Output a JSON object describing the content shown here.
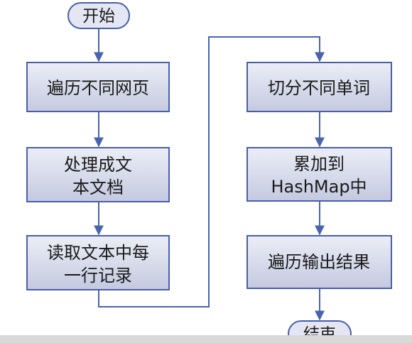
{
  "flowchart": {
    "start": {
      "label": "开始"
    },
    "left_column": [
      {
        "id": "step-traverse-pages",
        "lines": [
          "遍历不同网页"
        ]
      },
      {
        "id": "step-process-doc",
        "lines": [
          "处理成文",
          "本文档"
        ]
      },
      {
        "id": "step-read-lines",
        "lines": [
          "读取文本中每",
          "一行记录"
        ]
      }
    ],
    "right_column": [
      {
        "id": "step-split-words",
        "lines": [
          "切分不同单词"
        ]
      },
      {
        "id": "step-accumulate",
        "lines": [
          "累加到",
          "HashMap中"
        ]
      },
      {
        "id": "step-output",
        "lines": [
          "遍历输出结果"
        ]
      }
    ],
    "end": {
      "label": "结束"
    }
  },
  "colors": {
    "box_fill_top": "#eceef6",
    "box_fill_bottom": "#c4c9e0",
    "box_stroke": "#4a5ea8",
    "arrow": "#4a63ad",
    "terminal_fill": "#e4e7f3",
    "bottom_bar": "#d9d9d9"
  }
}
